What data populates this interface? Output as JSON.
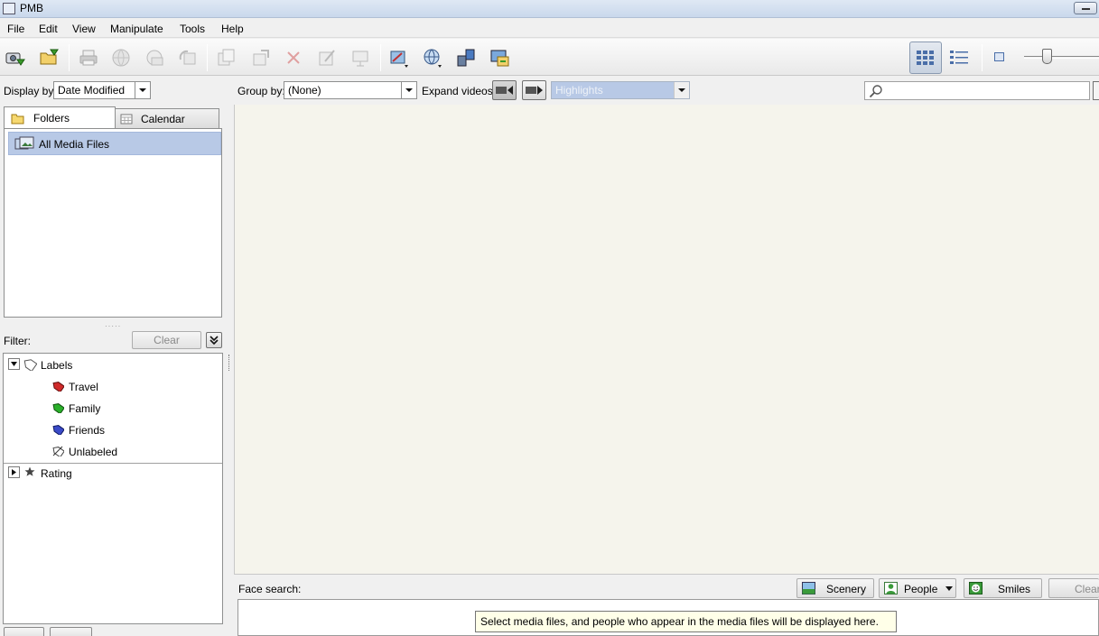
{
  "window": {
    "title": "PMB"
  },
  "menu": [
    "File",
    "Edit",
    "View",
    "Manipulate",
    "Tools",
    "Help"
  ],
  "left": {
    "display_by_label": "Display by:",
    "display_by_value": "Date Modified",
    "tabs": {
      "folders": "Folders",
      "calendar": "Calendar"
    },
    "folder_item": "All Media Files",
    "filter_label": "Filter:",
    "clear_label": "Clear",
    "labels_group": "Labels",
    "labels": [
      "Travel",
      "Family",
      "Friends",
      "Unlabeled"
    ],
    "rating_group": "Rating"
  },
  "content": {
    "group_by_label": "Group by:",
    "group_by_value": "(None)",
    "expand_videos_label": "Expand videos:",
    "highlights_value": "Highlights"
  },
  "face": {
    "label": "Face search:",
    "scenery": "Scenery",
    "people": "People",
    "smiles": "Smiles",
    "clear": "Clear",
    "tooltip": "Select media files, and people who appear in the media files will be displayed here."
  },
  "colors": {
    "selection": "#b8c9e6",
    "content_bg": "#f5f4ec",
    "tooltip_bg": "#ffffe8"
  }
}
